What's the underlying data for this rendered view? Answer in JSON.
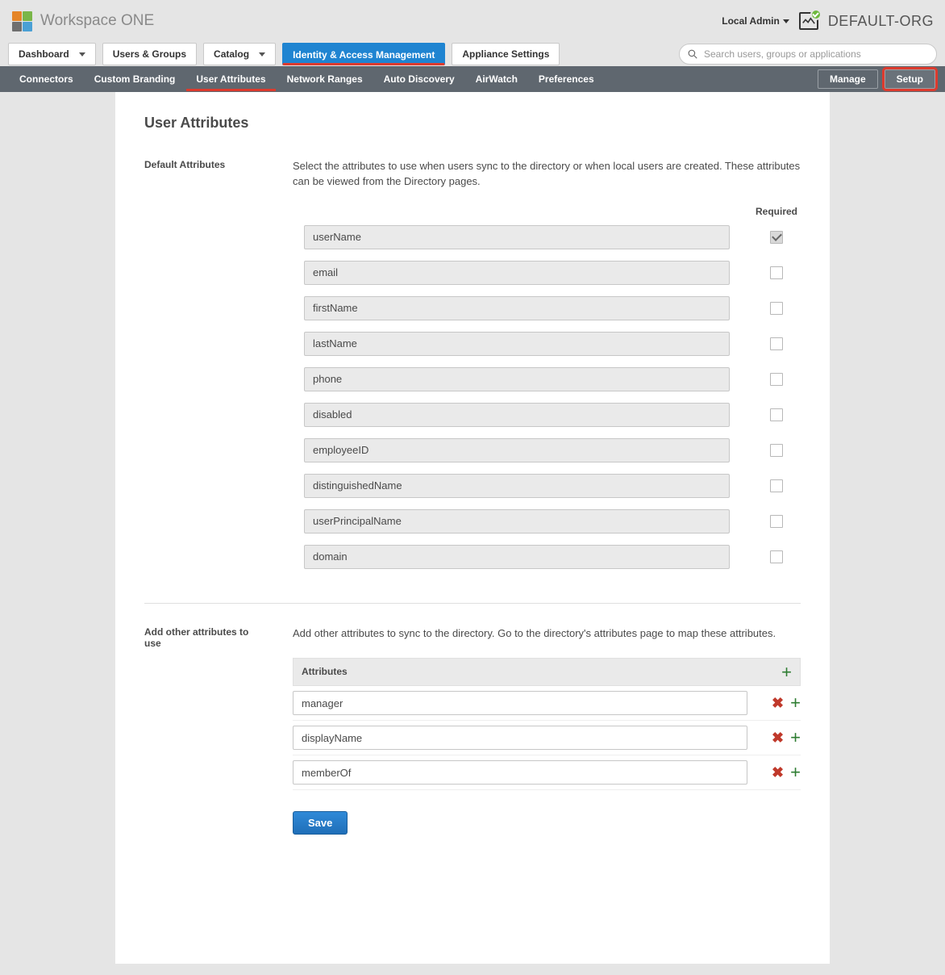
{
  "app": {
    "title": "Workspace ONE",
    "user_label": "Local Admin",
    "org_name": "DEFAULT-ORG",
    "search_placeholder": "Search users, groups or applications"
  },
  "main_nav": [
    {
      "label": "Dashboard",
      "dropdown": true,
      "active": false
    },
    {
      "label": "Users & Groups",
      "dropdown": false,
      "active": false
    },
    {
      "label": "Catalog",
      "dropdown": true,
      "active": false
    },
    {
      "label": "Identity & Access Management",
      "dropdown": false,
      "active": true
    },
    {
      "label": "Appliance Settings",
      "dropdown": false,
      "active": false
    }
  ],
  "sub_nav": {
    "items": [
      "Connectors",
      "Custom Branding",
      "User Attributes",
      "Network Ranges",
      "Auto Discovery",
      "AirWatch",
      "Preferences"
    ],
    "active_index": 2,
    "manage_label": "Manage",
    "setup_label": "Setup"
  },
  "page": {
    "title": "User Attributes",
    "default_section_label": "Default Attributes",
    "default_section_desc": "Select the attributes to use when users sync to the directory or when local users are created. These attributes can be viewed from the Directory pages.",
    "required_header": "Required",
    "default_attributes": [
      {
        "name": "userName",
        "required": true,
        "locked": true
      },
      {
        "name": "email",
        "required": false
      },
      {
        "name": "firstName",
        "required": false
      },
      {
        "name": "lastName",
        "required": false
      },
      {
        "name": "phone",
        "required": false
      },
      {
        "name": "disabled",
        "required": false
      },
      {
        "name": "employeeID",
        "required": false
      },
      {
        "name": "distinguishedName",
        "required": false
      },
      {
        "name": "userPrincipalName",
        "required": false
      },
      {
        "name": "domain",
        "required": false
      }
    ],
    "custom_section_label": "Add other attributes to use",
    "custom_section_desc": "Add other attributes to sync to the directory. Go to the directory's attributes page to map these attributes.",
    "custom_header": "Attributes",
    "custom_attributes": [
      "manager",
      "displayName",
      "memberOf"
    ],
    "save_label": "Save"
  }
}
